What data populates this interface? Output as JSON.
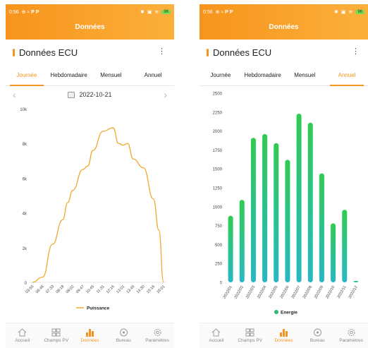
{
  "status": {
    "time": "0:56",
    "battery": "96"
  },
  "appbar_title": "Données",
  "section_title": "Données ECU",
  "tabs": [
    "Journée",
    "Hebdomadaire",
    "Mensuel",
    "Annuel"
  ],
  "date_selector": {
    "date": "2022-10-21",
    "prev": "‹",
    "next": "›"
  },
  "nav": [
    "Accueil",
    "Champs PV",
    "Données",
    "Bureau",
    "Paramètres"
  ],
  "colors": {
    "accent": "#f7941d",
    "line": "#f0a830",
    "bar_top": "#2ecc52",
    "bar_bottom": "#27b8c4",
    "legend_energy": "#2eb87a"
  },
  "chart_data": [
    {
      "type": "line",
      "legend": "Puissance",
      "y_ticks": [
        "0",
        "2k",
        "4k",
        "6k",
        "8k",
        "10k"
      ],
      "ylim": [
        0,
        10000
      ],
      "x_ticks": [
        "03:55",
        "06:46",
        "07:33",
        "08:18",
        "09:02",
        "09:47",
        "10:45",
        "11:31",
        "12:16",
        "13:01",
        "13:45",
        "14:30",
        "15:16",
        "16:01"
      ],
      "x": [
        "03:55",
        "06:46",
        "07:33",
        "08:18",
        "08:40",
        "09:02",
        "09:47",
        "10:15",
        "10:45",
        "11:31",
        "12:16",
        "12:40",
        "13:01",
        "13:20",
        "13:45",
        "14:30",
        "15:16",
        "15:40",
        "16:01"
      ],
      "values": [
        0,
        300,
        2200,
        3600,
        4600,
        5300,
        6500,
        6700,
        7600,
        8700,
        8900,
        8000,
        7900,
        8000,
        7100,
        6600,
        4800,
        3000,
        0
      ]
    },
    {
      "type": "bar",
      "legend": "Energie",
      "y_ticks": [
        "0",
        "250",
        "500",
        "750",
        "1000",
        "1250",
        "1500",
        "1750",
        "2000",
        "2250",
        "2500"
      ],
      "ylim": [
        0,
        2500
      ],
      "categories": [
        "2022/01",
        "2022/02",
        "2022/03",
        "2022/04",
        "2022/05",
        "2022/06",
        "2022/07",
        "2022/08",
        "2022/09",
        "2022/10",
        "2022/11",
        "2022/12"
      ],
      "values": [
        880,
        1090,
        1910,
        1960,
        1840,
        1620,
        2230,
        2110,
        1440,
        780,
        960,
        20
      ]
    }
  ]
}
